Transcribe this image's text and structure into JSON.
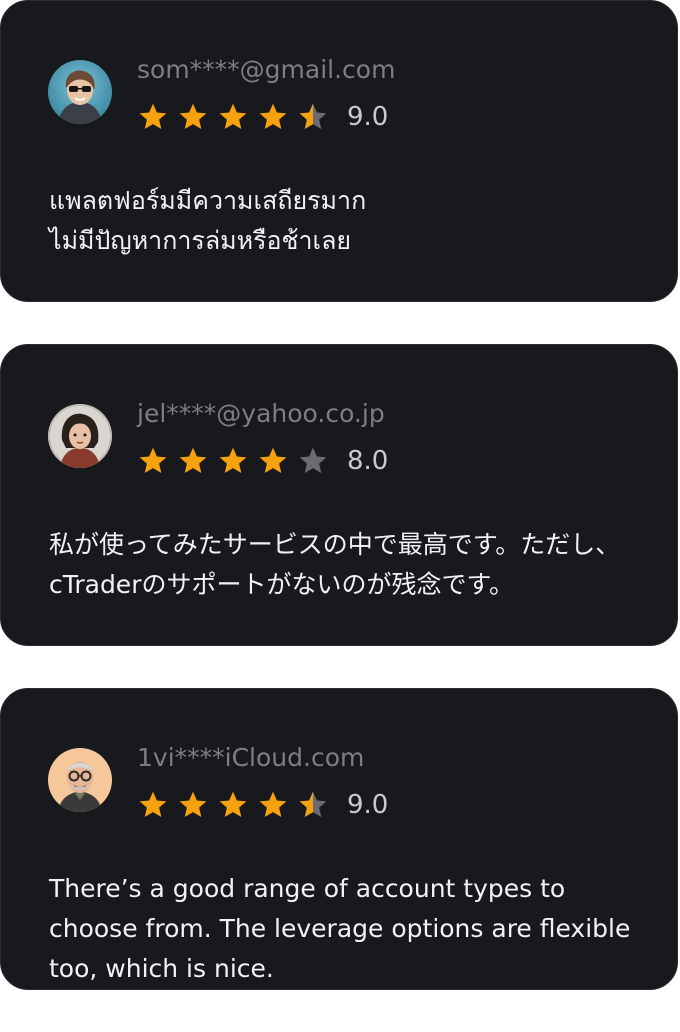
{
  "reviews": [
    {
      "email": "som****@gmail.com",
      "rating": 4.5,
      "score": "9.0",
      "text": "แพลตฟอร์มมีความเสถียรมาก\nไม่มีปัญหาการล่มหรือช้าเลย",
      "avatar": "woman-sunglasses-avatar"
    },
    {
      "email": "jel****@yahoo.co.jp",
      "rating": 4,
      "score": "8.0",
      "text": "私が使ってみたサービスの中で最高です。ただし、cTraderのサポートがないのが残念です。",
      "avatar": "woman-headphones-avatar"
    },
    {
      "email": "1vi****iCloud.com",
      "rating": 4.5,
      "score": "9.0",
      "text": "There’s a good range of account types to choose from. The leverage options are flexible too, which is nice.",
      "avatar": "man-glasses-avatar"
    }
  ],
  "colors": {
    "card_bg": "#18191d",
    "star_filled": "#f7a10d",
    "star_empty": "#6b6c71",
    "email": "#7d7e84",
    "score": "#c9cacf",
    "text": "#f2f2f4"
  }
}
